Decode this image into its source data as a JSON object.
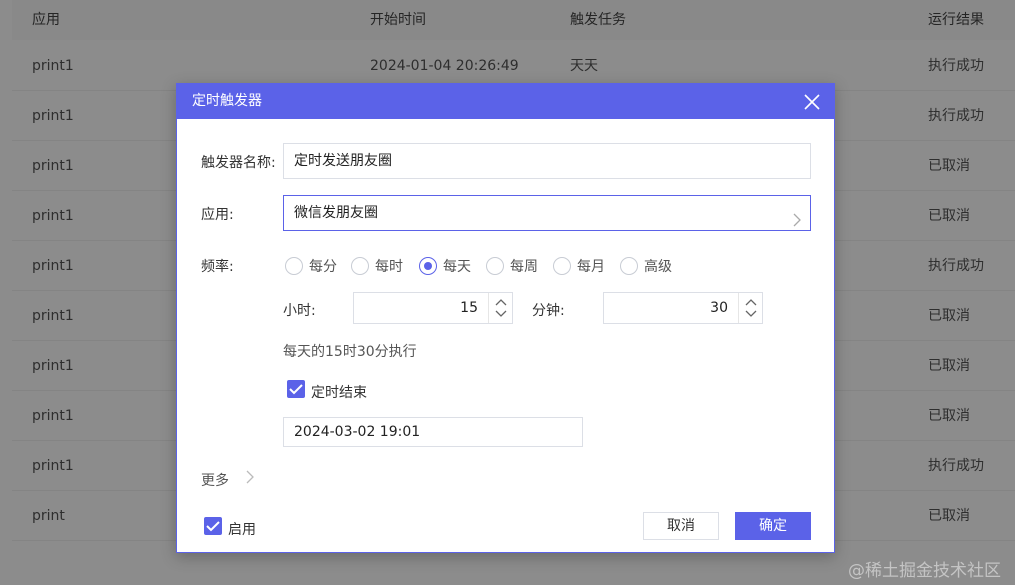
{
  "table": {
    "headers": {
      "app": "应用",
      "start": "开始时间",
      "task": "触发任务",
      "result": "运行结果"
    },
    "rows": [
      {
        "app": "print1",
        "start": "2024-01-04 20:26:49",
        "task": "天天",
        "result": "执行成功",
        "status": "ok"
      },
      {
        "app": "print1",
        "start": "",
        "task": "",
        "result": "执行成功",
        "status": "ok"
      },
      {
        "app": "print1",
        "start": "",
        "task": "",
        "result": "已取消",
        "status": "cancel"
      },
      {
        "app": "print1",
        "start": "",
        "task": "",
        "result": "已取消",
        "status": "cancel"
      },
      {
        "app": "print1",
        "start": "",
        "task": "",
        "result": "执行成功",
        "status": "ok"
      },
      {
        "app": "print1",
        "start": "",
        "task": "",
        "result": "已取消",
        "status": "cancel"
      },
      {
        "app": "print1",
        "start": "",
        "task": "",
        "result": "已取消",
        "status": "cancel"
      },
      {
        "app": "print1",
        "start": "",
        "task": "",
        "result": "已取消",
        "status": "cancel"
      },
      {
        "app": "print1",
        "start": "",
        "task": "",
        "result": "执行成功",
        "status": "ok"
      },
      {
        "app": "print",
        "start": "",
        "task": "",
        "result": "已取消",
        "status": "cancel"
      }
    ]
  },
  "dialog": {
    "title": "定时触发器",
    "name_label": "触发器名称:",
    "name_value": "定时发送朋友圈",
    "app_label": "应用:",
    "app_value": "微信发朋友圈",
    "freq_label": "频率:",
    "freq_options": [
      "每分",
      "每时",
      "每天",
      "每周",
      "每月",
      "高级"
    ],
    "freq_selected": "每天",
    "hour_label": "小时:",
    "hour_value": "15",
    "minute_label": "分钟:",
    "minute_value": "30",
    "summary": "每天的15时30分执行",
    "end_label": "定时结束",
    "end_checked": true,
    "end_datetime": "2024-03-02 19:01",
    "more_label": "更多",
    "enable_label": "启用",
    "enable_checked": true,
    "cancel_label": "取消",
    "ok_label": "确定"
  },
  "watermark": "@稀土掘金技术社区",
  "colors": {
    "accent": "#5b62e8",
    "cancel_text": "#e0484b",
    "overlay": "rgba(0,0,0,0.45)"
  }
}
